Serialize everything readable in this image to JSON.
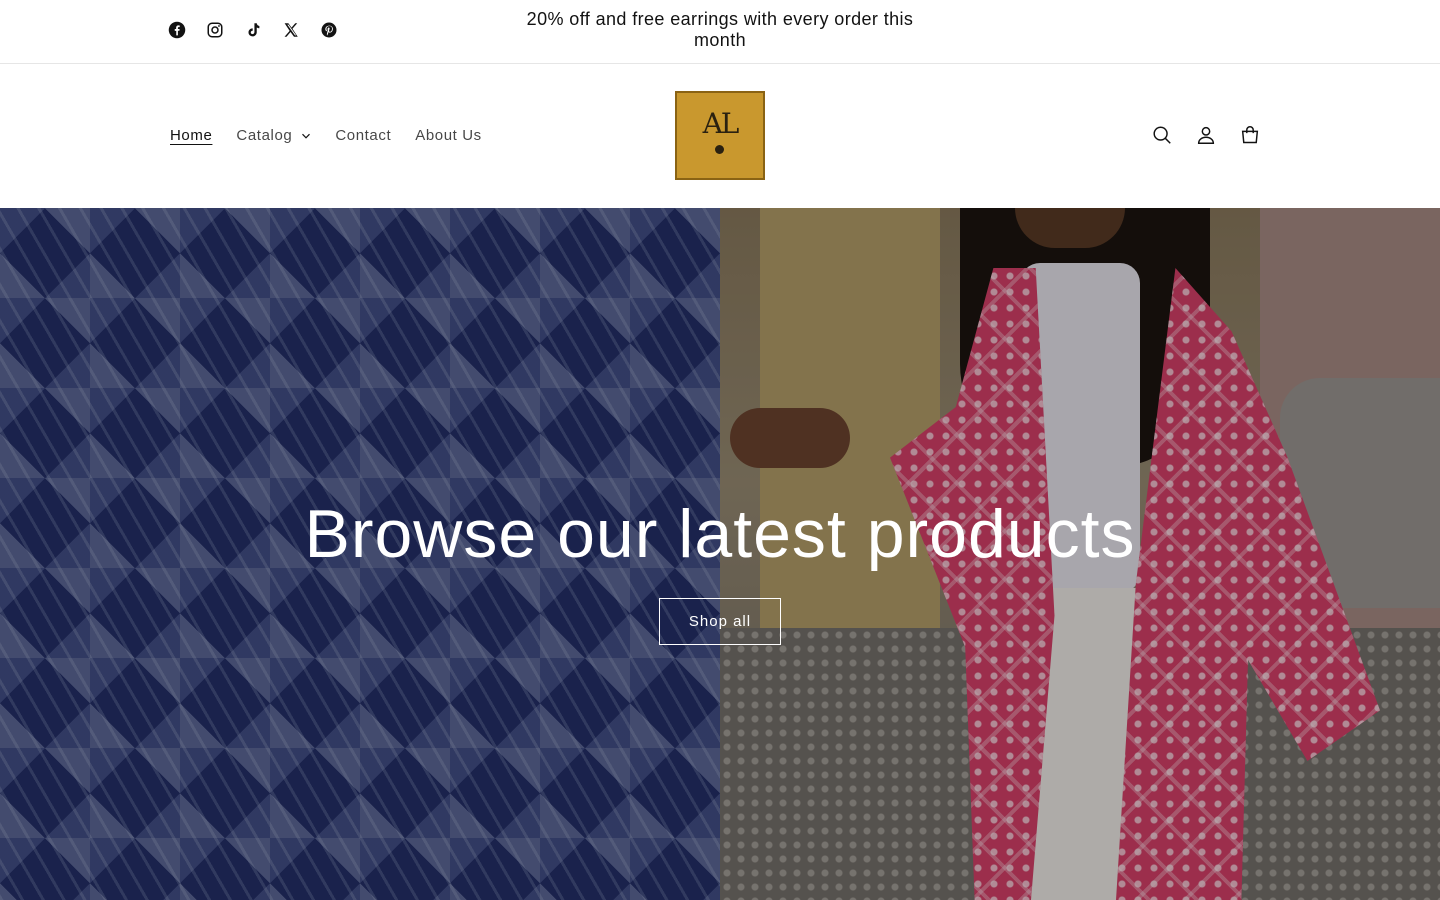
{
  "announcement": {
    "text": "20% off and free earrings with every order this month"
  },
  "social": [
    {
      "name": "facebook-icon"
    },
    {
      "name": "instagram-icon"
    },
    {
      "name": "tiktok-icon"
    },
    {
      "name": "x-icon"
    },
    {
      "name": "pinterest-icon"
    }
  ],
  "nav": {
    "items": [
      {
        "label": "Home",
        "active": true
      },
      {
        "label": "Catalog",
        "has_dropdown": true
      },
      {
        "label": "Contact"
      },
      {
        "label": "About Us"
      }
    ]
  },
  "logo": {
    "mark": "AL",
    "background": "#c9982e"
  },
  "header_icons": [
    "search-icon",
    "account-icon",
    "cart-icon"
  ],
  "hero": {
    "title": "Browse our latest products",
    "button_label": "Shop all"
  },
  "colors": {
    "text": "#121212",
    "hero_text": "#ffffff",
    "logo_gold": "#c9982e"
  }
}
